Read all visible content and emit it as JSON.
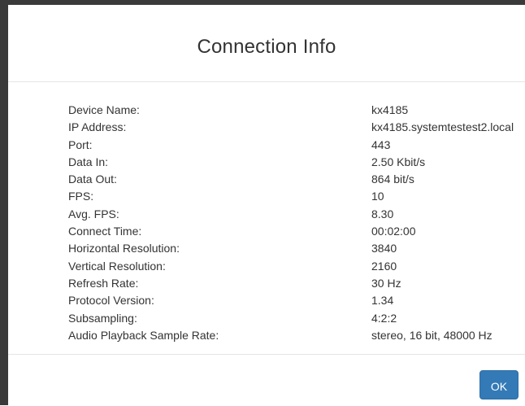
{
  "dialog": {
    "title": "Connection Info",
    "rows": [
      {
        "label": "Device Name:",
        "value": "kx4185"
      },
      {
        "label": "IP Address:",
        "value": "kx4185.systemtestest2.local"
      },
      {
        "label": "Port:",
        "value": "443"
      },
      {
        "label": "Data In:",
        "value": "2.50 Kbit/s"
      },
      {
        "label": "Data Out:",
        "value": "864 bit/s"
      },
      {
        "label": "FPS:",
        "value": "10"
      },
      {
        "label": "Avg. FPS:",
        "value": "8.30"
      },
      {
        "label": "Connect Time:",
        "value": "00:02:00"
      },
      {
        "label": "Horizontal Resolution:",
        "value": "3840"
      },
      {
        "label": "Vertical Resolution:",
        "value": "2160"
      },
      {
        "label": "Refresh Rate:",
        "value": "30 Hz"
      },
      {
        "label": "Protocol Version:",
        "value": "1.34"
      },
      {
        "label": "Subsampling:",
        "value": "4:2:2"
      },
      {
        "label": "Audio Playback Sample Rate:",
        "value": "stereo, 16 bit, 48000 Hz"
      }
    ],
    "ok_label": "OK"
  },
  "colors": {
    "primary_button": "#337ab7",
    "text": "#333333",
    "divider": "#e5e5e5"
  }
}
